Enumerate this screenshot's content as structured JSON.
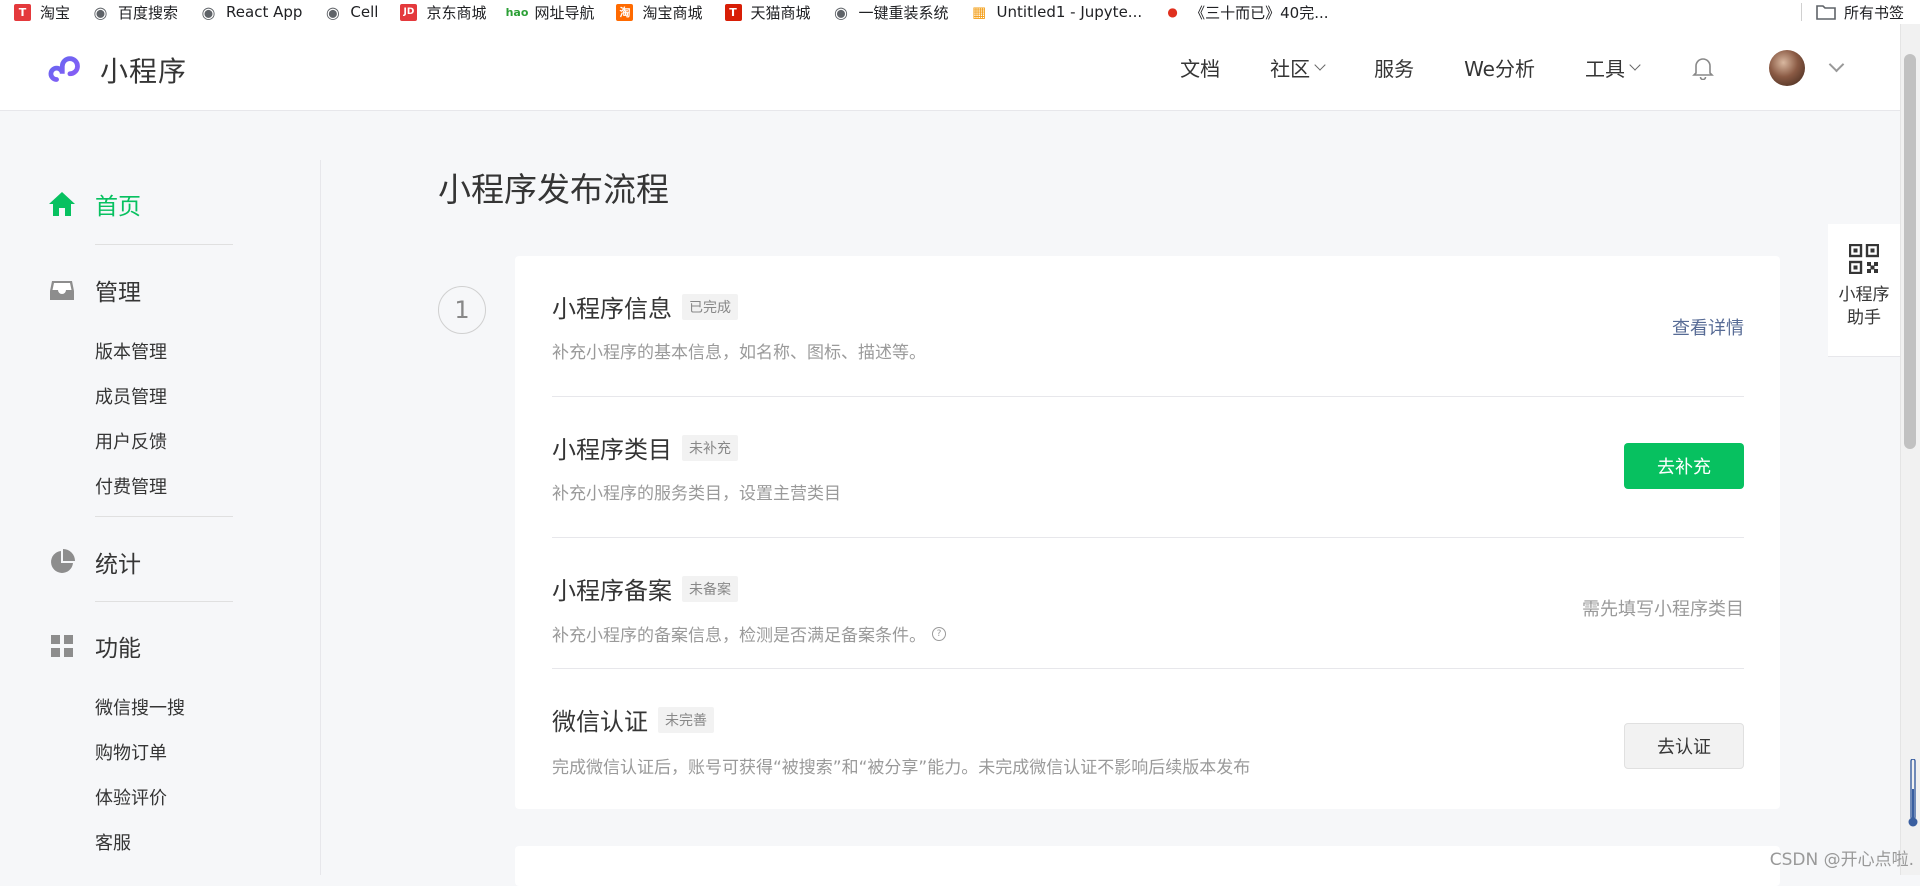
{
  "bookmarks": [
    {
      "label": "淘宝",
      "icon": "taobao-t-icon"
    },
    {
      "label": "百度搜索",
      "icon": "globe-icon"
    },
    {
      "label": "React App",
      "icon": "globe-icon"
    },
    {
      "label": "Cell",
      "icon": "globe-icon"
    },
    {
      "label": "京东商城",
      "icon": "jd-icon"
    },
    {
      "label": "网址导航",
      "icon": "hao-icon"
    },
    {
      "label": "淘宝商城",
      "icon": "taobao-mall-icon"
    },
    {
      "label": "天猫商城",
      "icon": "tmall-icon"
    },
    {
      "label": "一键重装系统",
      "icon": "globe-icon"
    },
    {
      "label": "Untitled1 - Jupyte...",
      "icon": "jupyter-icon"
    },
    {
      "label": "《三十而已》40完...",
      "icon": "video-icon"
    }
  ],
  "all_bookmarks": "所有书签",
  "header": {
    "logo_text": "小程序",
    "nav": {
      "docs": "文档",
      "community": "社区",
      "service": "服务",
      "analytics": "We分析",
      "tools": "工具"
    }
  },
  "sidebar": {
    "home": "首页",
    "manage": "管理",
    "manage_items": [
      "版本管理",
      "成员管理",
      "用户反馈",
      "付费管理"
    ],
    "stats": "统计",
    "features": "功能",
    "feature_items": [
      "微信搜一搜",
      "购物订单",
      "体验评价",
      "客服"
    ]
  },
  "main": {
    "title": "小程序发布流程",
    "step_number": "1",
    "rows": [
      {
        "title": "小程序信息",
        "tag": "已完成",
        "desc": "补充小程序的基本信息，如名称、图标、描述等。",
        "action": "查看详情"
      },
      {
        "title": "小程序类目",
        "tag": "未补充",
        "desc": "补充小程序的服务类目，设置主营类目",
        "action": "去补充"
      },
      {
        "title": "小程序备案",
        "tag": "未备案",
        "desc": "补充小程序的备案信息，检测是否满足备案条件。",
        "action": "需先填写小程序类目"
      },
      {
        "title": "微信认证",
        "tag": "未完善",
        "desc": "完成微信认证后，账号可获得“被搜索”和“被分享”能力。未完成微信认证不影响后续版本发布",
        "action": "去认证"
      }
    ]
  },
  "assistant": {
    "label": "小程序助手"
  },
  "watermark": "CSDN @开心点啦.",
  "colors": {
    "accent": "#07c160",
    "link": "#576b95"
  }
}
